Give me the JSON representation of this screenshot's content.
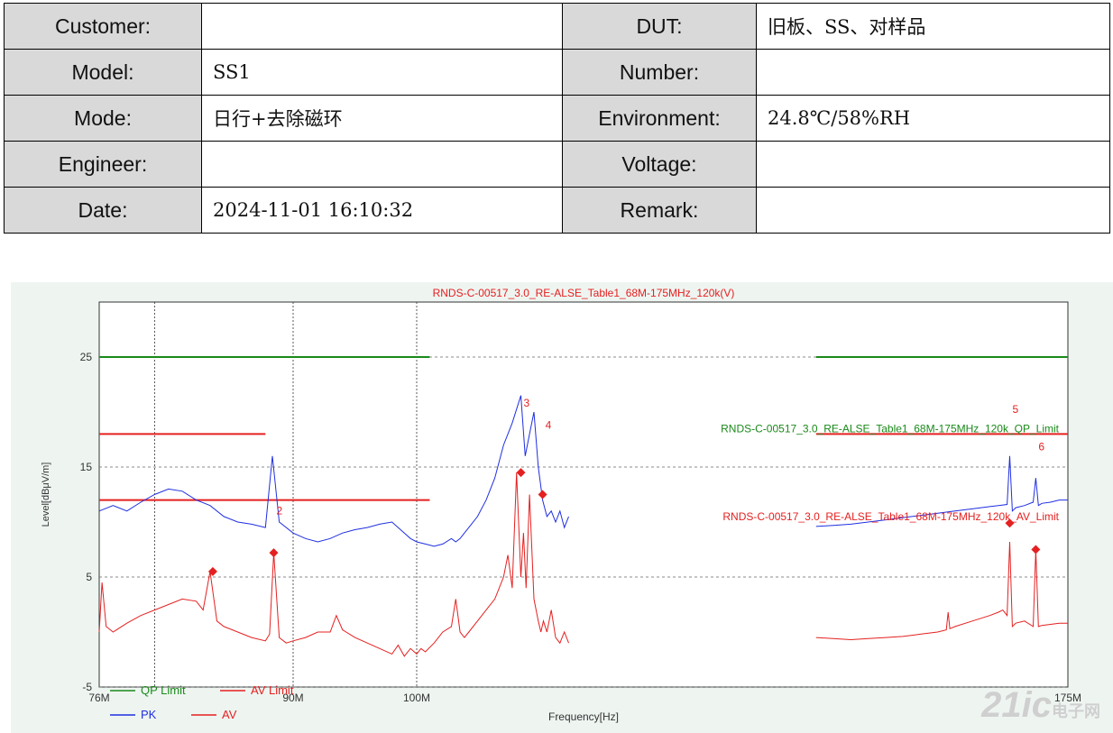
{
  "info_table": {
    "rows": [
      {
        "label1": "Customer:",
        "value1": "",
        "label2": "DUT:",
        "value2": "旧板、SS、对样品"
      },
      {
        "label1": "Model:",
        "value1": "SS1",
        "label2": "Number:",
        "value2": ""
      },
      {
        "label1": "Mode:",
        "value1": "日行+去除磁环",
        "label2": "Environment:",
        "value2": "24.8℃/58%RH"
      },
      {
        "label1": "Engineer:",
        "value1": "",
        "label2": "Voltage:",
        "value2": ""
      },
      {
        "label1": "Date:",
        "value1": "2024-11-01 16:10:32",
        "label2": "Remark:",
        "value2": ""
      }
    ]
  },
  "watermark": {
    "text": "21ic",
    "subtext": "电子网"
  },
  "chart_data": {
    "type": "line",
    "title": "RNDS-C-00517_3.0_RE-ALSE_Table1_68M-175MHz_120k(V)",
    "xlabel": "Frequency[Hz]",
    "ylabel": "Level[dBμV/m]",
    "xlim": [
      76,
      175
    ],
    "ylim": [
      -5,
      30
    ],
    "xticks": [
      {
        "v": 76,
        "label": "76M"
      },
      {
        "v": 90,
        "label": "90M"
      },
      {
        "v": 100,
        "label": "100M"
      },
      {
        "v": 175,
        "label": "175M"
      }
    ],
    "yticks": [
      -5,
      5,
      15,
      25
    ],
    "grid": true,
    "limit_annotations": [
      {
        "text": "RNDS-C-00517_3.0_RE-ALSE_Table1_68M-175MHz_120k_QP_Limit",
        "color": "#1a8a1a",
        "y": 18
      },
      {
        "text": "RNDS-C-00517_3.0_RE-ALSE_Table1_68M-175MHz_120k_AV_Limit",
        "color": "#e52020",
        "y": 10
      }
    ],
    "limits": [
      {
        "name": "QP Limit",
        "color": "#1a8a1a",
        "segments": [
          [
            76,
            101.5,
            25
          ],
          [
            146,
            175,
            25
          ]
        ]
      },
      {
        "name": "AV Limit",
        "color": "#e52020",
        "segments": [
          [
            76,
            88,
            18
          ],
          [
            76,
            101.5,
            12
          ],
          [
            146,
            175,
            18
          ]
        ]
      }
    ],
    "series": [
      {
        "name": "PK",
        "color": "#1f2fe0",
        "segments": [
          {
            "x": [
              76,
              77,
              78,
              79,
              80,
              81,
              82,
              83,
              84,
              85,
              86,
              87,
              88,
              88.5,
              89,
              90,
              91,
              92,
              93,
              94,
              95,
              96,
              97,
              98,
              98.5,
              99,
              99.5,
              100,
              101,
              102,
              103,
              104,
              104.5,
              105,
              105.5,
              106,
              107,
              108,
              109,
              110,
              111,
              112,
              112.5,
              113,
              113.5,
              114,
              114.5,
              115,
              115.5,
              116,
              116.5,
              117,
              117.5
            ],
            "y": [
              11,
              11.5,
              11,
              11.8,
              12.5,
              13,
              12.8,
              12,
              11.5,
              10.5,
              10,
              9.8,
              9.5,
              16,
              10,
              9,
              8.5,
              8.2,
              8.5,
              9,
              9.3,
              9.5,
              9.8,
              10,
              9.5,
              9,
              8.5,
              8.2,
              8,
              7.8,
              8,
              8.5,
              8.2,
              8.5,
              9,
              9.5,
              10.5,
              12,
              14,
              17,
              19,
              21.5,
              16,
              18,
              20,
              15,
              12,
              10.5,
              11,
              10,
              11,
              9.5,
              10.5
            ]
          },
          {
            "x": [
              146,
              148,
              150,
              152,
              154,
              156,
              158,
              160,
              162,
              164,
              166,
              167,
              168,
              168.3,
              168.6,
              169,
              170,
              171,
              171.3,
              171.6,
              172,
              173,
              174,
              175
            ],
            "y": [
              9.6,
              9.7,
              9.8,
              10,
              10.2,
              10.4,
              10.6,
              10.8,
              11,
              11.2,
              11.4,
              11.5,
              11.6,
              16,
              11,
              11.3,
              11.5,
              11.8,
              14,
              11.5,
              11.7,
              11.8,
              12,
              12
            ]
          }
        ]
      },
      {
        "name": "AV",
        "color": "#e52020",
        "segments": [
          {
            "x": [
              76,
              76.2,
              76.5,
              77,
              78,
              79,
              80,
              81,
              82,
              83,
              83.5,
              84,
              84.5,
              85,
              86,
              87,
              88,
              88.3,
              88.6,
              89,
              89.5,
              90,
              91,
              92,
              93,
              93.5,
              94,
              95,
              96,
              97,
              98,
              98.5,
              99,
              99.5,
              100,
              100.5,
              101,
              102,
              103,
              104,
              104.5,
              105,
              105.5,
              106,
              107,
              108,
              109,
              110,
              110.5,
              111,
              111.5,
              112,
              112.3,
              112.6,
              113,
              113.5,
              114,
              114.3,
              114.6,
              115,
              115.5,
              116,
              116.5,
              117,
              117.5
            ],
            "y": [
              0,
              4.5,
              0.5,
              0,
              0.8,
              1.5,
              2,
              2.5,
              3,
              2.8,
              2,
              5.5,
              1,
              0.5,
              0,
              -0.5,
              -0.8,
              -0.2,
              7.2,
              -0.5,
              -1,
              -0.8,
              -0.5,
              0,
              0,
              1.5,
              0.2,
              -0.5,
              -1,
              -1.5,
              -2,
              -1.2,
              -2.2,
              -1.5,
              -2,
              -1.5,
              -1.8,
              -1,
              0,
              0.5,
              3,
              0,
              -0.5,
              0,
              1,
              2,
              3,
              5,
              7,
              4,
              14.5,
              5,
              9,
              4,
              12.5,
              3,
              1,
              0,
              1,
              0,
              2,
              -0.5,
              -1,
              0,
              -1
            ]
          },
          {
            "x": [
              146,
              148,
              150,
              152,
              154,
              156,
              158,
              160,
              161,
              161.2,
              161.4,
              162,
              164,
              166,
              167,
              167.5,
              168,
              168.3,
              168.6,
              169,
              170,
              171,
              171.3,
              171.6,
              172,
              174,
              175
            ],
            "y": [
              -0.5,
              -0.6,
              -0.7,
              -0.6,
              -0.5,
              -0.4,
              -0.2,
              0,
              0.2,
              1.8,
              0.3,
              0.5,
              1,
              1.5,
              1.8,
              2,
              1.5,
              8.2,
              0.5,
              0.8,
              1,
              0.5,
              7.5,
              0.5,
              0.6,
              0.8,
              0.8
            ]
          }
        ]
      }
    ],
    "markers": [
      {
        "label": "",
        "x": 84.2,
        "y": 5.5
      },
      {
        "label": "2",
        "x": 88.6,
        "y": 7.2
      },
      {
        "label": "3",
        "x": 112,
        "y": 14.5
      },
      {
        "label": "4",
        "x": 114.5,
        "y": 12.5
      },
      {
        "label": "5",
        "x": 168.3,
        "y": 9.9
      },
      {
        "label": "6",
        "x": 171.3,
        "y": 7.5
      }
    ],
    "marker_color": "#e52020",
    "legend": {
      "placement": "bottom-left",
      "entries": [
        {
          "name": "QP Limit",
          "color": "#1a8a1a"
        },
        {
          "name": "AV Limit",
          "color": "#e52020"
        },
        {
          "name": "PK",
          "color": "#1f2fe0"
        },
        {
          "name": "AV",
          "color": "#e52020"
        }
      ]
    }
  }
}
